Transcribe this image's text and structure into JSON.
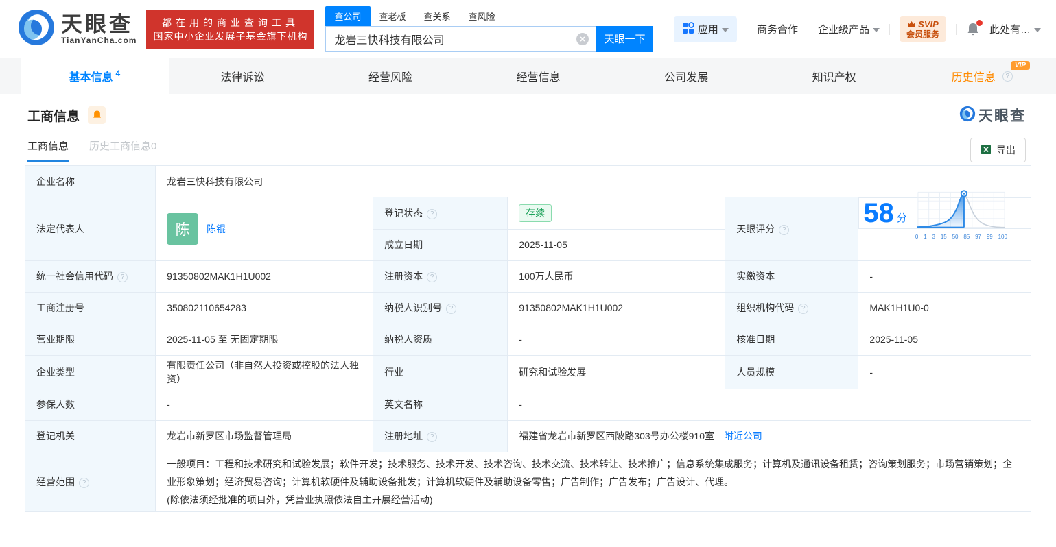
{
  "brand": {
    "logo_title": "天眼查",
    "logo_domain": "TianYanCha.com",
    "slogan_line1": "都在用的商业查询工具",
    "slogan_line2": "国家中小企业发展子基金旗下机构"
  },
  "search": {
    "tabs": [
      {
        "label": "查公司"
      },
      {
        "label": "查老板"
      },
      {
        "label": "查关系"
      },
      {
        "label": "查风险"
      }
    ],
    "value": "龙岩三快科技有限公司",
    "button": "天眼一下"
  },
  "top_nav": {
    "apps": "应用",
    "cooperation": "商务合作",
    "enterprise": "企业级产品",
    "svip_line1": "SVIP",
    "svip_line2": "会员服务",
    "user": "此处有…"
  },
  "main_tabs": [
    {
      "label": "基本信息",
      "count": "4"
    },
    {
      "label": "法律诉讼"
    },
    {
      "label": "经营风险"
    },
    {
      "label": "经营信息"
    },
    {
      "label": "公司发展"
    },
    {
      "label": "知识产权"
    },
    {
      "label": "历史信息",
      "vip_badge": "VIP"
    }
  ],
  "section": {
    "title": "工商信息",
    "subtab_current": "工商信息",
    "subtab_history": "历史工商信息0",
    "watermark": "天眼查",
    "export_label": "导出"
  },
  "info": {
    "company_name": {
      "label": "企业名称",
      "value": "龙岩三快科技有限公司"
    },
    "legal_rep": {
      "label": "法定代表人",
      "avatar": "陈",
      "name": "陈锟"
    },
    "reg_status": {
      "label": "登记状态",
      "value": "存续"
    },
    "establish_date": {
      "label": "成立日期",
      "value": "2025-11-05"
    },
    "score": {
      "label": "天眼评分",
      "value": "58",
      "unit": "分"
    },
    "credit_code": {
      "label": "统一社会信用代码",
      "value": "91350802MAK1H1U002"
    },
    "reg_capital": {
      "label": "注册资本",
      "value": "100万人民币"
    },
    "paid_capital": {
      "label": "实缴资本",
      "value": "-"
    },
    "reg_number": {
      "label": "工商注册号",
      "value": "350802110654283"
    },
    "taxpayer_id": {
      "label": "纳税人识别号",
      "value": "91350802MAK1H1U002"
    },
    "org_code": {
      "label": "组织机构代码",
      "value": "MAK1H1U0-0"
    },
    "business_term": {
      "label": "营业期限",
      "value": "2025-11-05 至 无固定期限"
    },
    "taxpayer_quality": {
      "label": "纳税人资质",
      "value": "-"
    },
    "approval_date": {
      "label": "核准日期",
      "value": "2025-11-05"
    },
    "company_type": {
      "label": "企业类型",
      "value": "有限责任公司（非自然人投资或控股的法人独资）"
    },
    "industry": {
      "label": "行业",
      "value": "研究和试验发展"
    },
    "staff_size": {
      "label": "人员规模",
      "value": "-"
    },
    "insured_count": {
      "label": "参保人数",
      "value": "-"
    },
    "english_name": {
      "label": "英文名称",
      "value": "-"
    },
    "reg_authority": {
      "label": "登记机关",
      "value": "龙岩市新罗区市场监督管理局"
    },
    "reg_address": {
      "label": "注册地址",
      "value": "福建省龙岩市新罗区西陂路303号办公楼910室",
      "nearby_link": "附近公司"
    },
    "business_scope": {
      "label": "经营范围",
      "value": "一般项目：工程和技术研究和试验发展；软件开发；技术服务、技术开发、技术咨询、技术交流、技术转让、技术推广；信息系统集成服务；计算机及通讯设备租赁；咨询策划服务；市场营销策划；企业形象策划；经济贸易咨询；计算机软硬件及辅助设备批发；计算机软硬件及辅助设备零售；广告制作；广告发布；广告设计、代理。",
      "note": "(除依法须经批准的项目外，凭营业执照依法自主开展经营活动)"
    }
  },
  "chart_data": {
    "type": "area",
    "title": "天眼评分分布曲线",
    "score": 58,
    "ticks": [
      "0",
      "1",
      "3",
      "15",
      "50",
      "85",
      "97",
      "99",
      "100"
    ],
    "xlabel": "",
    "ylabel": "",
    "legend": [],
    "grid": true
  }
}
